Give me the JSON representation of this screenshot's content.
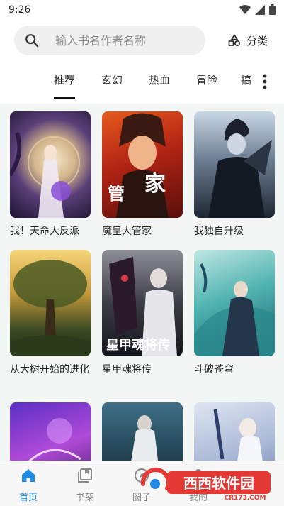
{
  "status_bar": {
    "time": "9:26"
  },
  "search": {
    "placeholder": "输入书名作者名称"
  },
  "category_button": {
    "label": "分类"
  },
  "tabs": [
    {
      "label": "推荐",
      "active": true
    },
    {
      "label": "玄幻",
      "active": false
    },
    {
      "label": "热血",
      "active": false
    },
    {
      "label": "冒险",
      "active": false
    }
  ],
  "tab_overflow": {
    "label": "搞"
  },
  "books": [
    {
      "title": "我！天命大反派"
    },
    {
      "title": "魔皇大管家"
    },
    {
      "title": "我独自升级"
    },
    {
      "title": "从大树开始的进化"
    },
    {
      "title": "星甲魂将传"
    },
    {
      "title": "斗破苍穹"
    },
    {
      "title": ""
    },
    {
      "title": ""
    },
    {
      "title": ""
    }
  ],
  "bottom_nav": [
    {
      "label": "首页",
      "active": true
    },
    {
      "label": "书架",
      "active": false
    },
    {
      "label": "圈子",
      "active": false
    },
    {
      "label": "我的",
      "active": false
    }
  ],
  "watermark": {
    "text": "西西软件园",
    "sub": "CR173.COM"
  },
  "colors": {
    "accent": "#1e88e5",
    "content_bg": "#f2f7f6"
  }
}
